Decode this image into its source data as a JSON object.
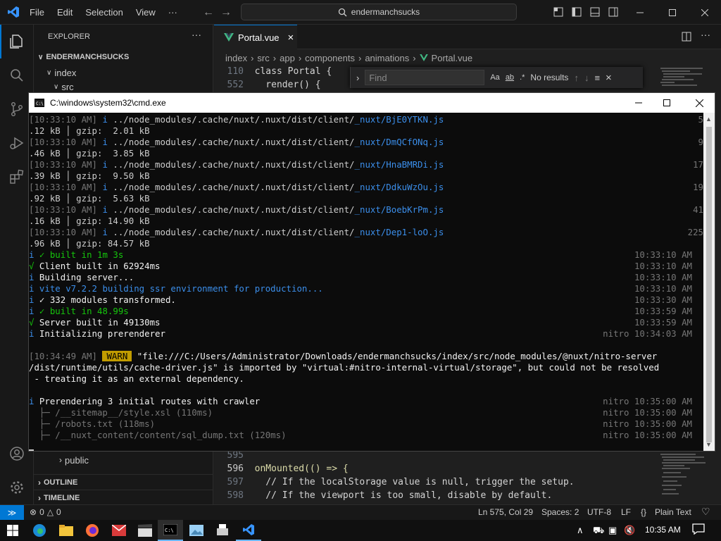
{
  "titlebar": {
    "menu": [
      "File",
      "Edit",
      "Selection",
      "View",
      "···"
    ],
    "search": "endermanchsucks"
  },
  "sidebar": {
    "title": "EXPLORER",
    "root": "ENDERMANCHSUCKS",
    "items": {
      "index": "index",
      "src": "src",
      "public": "public"
    },
    "sections": {
      "outline": "OUTLINE",
      "timeline": "TIMELINE"
    }
  },
  "editor": {
    "tab": "Portal.vue",
    "breadcrumb": [
      "index",
      "src",
      "app",
      "components",
      "animations",
      "Portal.vue"
    ],
    "top_lines": [
      {
        "n": "110",
        "code": "class Portal {"
      },
      {
        "n": "552",
        "code": "  render() {"
      }
    ],
    "bottom_lines": [
      {
        "n": "595",
        "code": ""
      },
      {
        "n": "596",
        "code": "onMounted(() => {"
      },
      {
        "n": "597",
        "code": "  // If the localStorage value is null, trigger the setup."
      },
      {
        "n": "598",
        "code": "  // If the viewport is too small, disable by default."
      }
    ],
    "find": {
      "placeholder": "Find",
      "result": "No results"
    }
  },
  "cmd": {
    "title": "C:\\windows\\system32\\cmd.exe",
    "lines": [
      {
        "t": "[10:33:10 AM] ",
        "i": "i",
        "p": " ../node_modules/.cache/nuxt/.nuxt/dist/client/",
        "f": "_nuxt/BjE0YTKN.js",
        "r": "5"
      },
      {
        "g": ".12 kB │ gzip:  2.01 kB"
      },
      {
        "t": "[10:33:10 AM] ",
        "i": "i",
        "p": " ../node_modules/.cache/nuxt/.nuxt/dist/client/",
        "f": "_nuxt/DmQCfONq.js",
        "r": "9"
      },
      {
        "g": ".46 kB │ gzip:  3.85 kB"
      },
      {
        "t": "[10:33:10 AM] ",
        "i": "i",
        "p": " ../node_modules/.cache/nuxt/.nuxt/dist/client/",
        "f": "_nuxt/HnaBMRDi.js",
        "r": "17"
      },
      {
        "g": ".39 kB │ gzip:  9.50 kB"
      },
      {
        "t": "[10:33:10 AM] ",
        "i": "i",
        "p": " ../node_modules/.cache/nuxt/.nuxt/dist/client/",
        "f": "_nuxt/DdkuWzOu.js",
        "r": "19"
      },
      {
        "g": ".92 kB │ gzip:  5.63 kB"
      },
      {
        "t": "[10:33:10 AM] ",
        "i": "i",
        "p": " ../node_modules/.cache/nuxt/.nuxt/dist/client/",
        "f": "_nuxt/BoebKrPm.js",
        "r": "41"
      },
      {
        "g": ".16 kB │ gzip: 14.90 kB"
      },
      {
        "t": "[10:33:10 AM] ",
        "i": "i",
        "p": " ../node_modules/.cache/nuxt/.nuxt/dist/client/",
        "f": "_nuxt/Dep1-loO.js",
        "r": "225"
      },
      {
        "g": ".96 kB │ gzip: 84.57 kB"
      }
    ],
    "status": [
      {
        "i": "i",
        "ic": "blue",
        "txt": " ✓ built in 1m 3s",
        "tc": "green",
        "time": "10:33:10 AM"
      },
      {
        "i": "√",
        "ic": "green",
        "txt": " Client built in 62924ms",
        "tc": "white",
        "time": "10:33:10 AM"
      },
      {
        "i": "i",
        "ic": "blue",
        "txt": " Building server...",
        "tc": "white",
        "time": "10:33:10 AM"
      },
      {
        "i": "i",
        "ic": "blue",
        "txt": " vite v7.2.2 building ssr environment for production...",
        "tc": "blue",
        "time": "10:33:10 AM"
      },
      {
        "i": "i",
        "ic": "blue",
        "txt": " ✓ 332 modules transformed.",
        "tc": "white",
        "time": "10:33:30 AM"
      },
      {
        "i": "i",
        "ic": "blue",
        "txt": " ✓ built in 48.99s",
        "tc": "green",
        "time": "10:33:59 AM"
      },
      {
        "i": "√",
        "ic": "green",
        "txt": " Server built in 49130ms",
        "tc": "white",
        "time": "10:33:59 AM"
      },
      {
        "i": "i",
        "ic": "blue",
        "txt": " Initializing prerenderer",
        "tc": "white",
        "time": "nitro 10:34:03 AM"
      }
    ],
    "warn": {
      "time": "[10:34:49 AM] ",
      "badge": "WARN",
      "l1": " \"file:///C:/Users/Administrator/Downloads/endermanchsucks/index/src/node_modules/@nuxt/nitro-server",
      "l2": "/dist/runtime/utils/cache-driver.js\" is imported by \"virtual:#nitro-internal-virtual/storage\", but could not be resolved",
      "l3": " - treating it as an external dependency."
    },
    "prerender": [
      {
        "i": "i",
        "txt": " Prerendering 3 initial routes with crawler",
        "tc": "white",
        "time": "nitro 10:35:00 AM"
      },
      {
        "i": "",
        "txt": "  ├─ /__sitemap__/style.xsl (110ms)",
        "tc": "gray",
        "time": "nitro 10:35:00 AM"
      },
      {
        "i": "",
        "txt": "  ├─ /robots.txt (118ms)",
        "tc": "gray",
        "time": "nitro 10:35:00 AM"
      },
      {
        "i": "",
        "txt": "  ├─ /__nuxt_content/content/sql_dump.txt (120ms)",
        "tc": "gray",
        "time": "nitro 10:35:00 AM"
      }
    ]
  },
  "statusbar": {
    "problems": "0",
    "warnings": "0",
    "position": "Ln 575, Col 29",
    "spaces": "Spaces: 2",
    "encoding": "UTF-8",
    "eol": "LF",
    "language": "Plain Text"
  },
  "taskbar": {
    "time": "10:35 AM"
  }
}
